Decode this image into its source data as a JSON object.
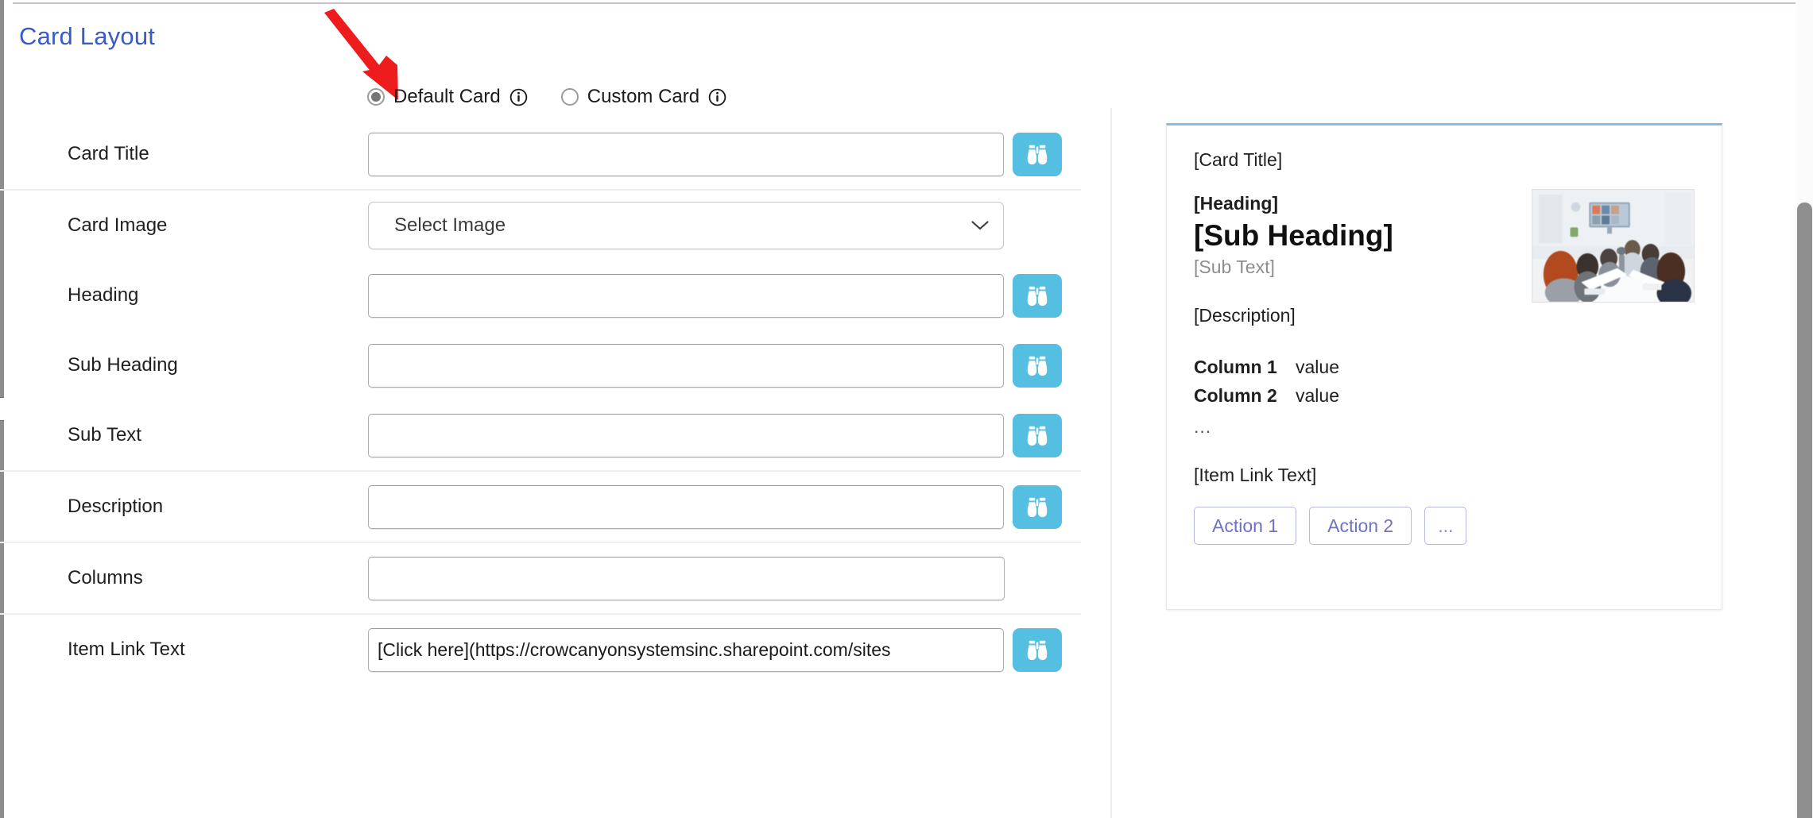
{
  "page": {
    "title": "Card Layout"
  },
  "layout_mode": {
    "options": [
      {
        "label": "Default Card",
        "selected": true,
        "info_icon": "info-circle-icon"
      },
      {
        "label": "Custom Card",
        "selected": false,
        "info_icon": "info-circle-icon"
      }
    ]
  },
  "form": {
    "groups": [
      {
        "rows": [
          {
            "label": "Card Title",
            "type": "text",
            "value": "",
            "has_picker": true,
            "picker_icon": "binoculars-icon"
          }
        ]
      },
      {
        "rows": [
          {
            "label": "Card Image",
            "type": "select",
            "value": "Select Image",
            "has_picker": false,
            "chevron_icon": "chevron-down-icon"
          },
          {
            "label": "Heading",
            "type": "text",
            "value": "",
            "has_picker": true,
            "picker_icon": "binoculars-icon"
          },
          {
            "label": "Sub Heading",
            "type": "text",
            "value": "",
            "has_picker": true,
            "picker_icon": "binoculars-icon"
          },
          {
            "label": "Sub Text",
            "type": "text",
            "value": "",
            "has_picker": true,
            "picker_icon": "binoculars-icon"
          }
        ]
      },
      {
        "rows": [
          {
            "label": "Description",
            "type": "text",
            "value": "",
            "has_picker": true,
            "picker_icon": "binoculars-icon"
          }
        ]
      },
      {
        "rows": [
          {
            "label": "Columns",
            "type": "text",
            "value": "",
            "has_picker": false
          }
        ]
      },
      {
        "rows": [
          {
            "label": "Item Link Text",
            "type": "text",
            "value": "[Click here](https://crowcanyonsystemsinc.sharepoint.com/sites",
            "has_picker": true,
            "picker_icon": "binoculars-icon"
          }
        ]
      }
    ]
  },
  "preview": {
    "card_title": "[Card Title]",
    "heading": "[Heading]",
    "sub_heading": "[Sub Heading]",
    "sub_text": "[Sub Text]",
    "description": "[Description]",
    "columns": [
      {
        "name": "Column 1",
        "value": "value"
      },
      {
        "name": "Column 2",
        "value": "value"
      }
    ],
    "more_indicator": "...",
    "item_link_text": "[Item Link Text]",
    "actions": [
      "Action 1",
      "Action 2",
      "..."
    ],
    "image_alt": "meeting-room-photo"
  },
  "annotation": {
    "arrow_color": "#ee1c1c",
    "target": "Default Card radio button"
  },
  "colors": {
    "title_blue": "#3a5bc7",
    "picker_blue": "#55bfe2",
    "card_top_border": "#8ab6e8",
    "action_button_purple": "#6d72c3",
    "arrow_red": "#ee1c1c"
  }
}
